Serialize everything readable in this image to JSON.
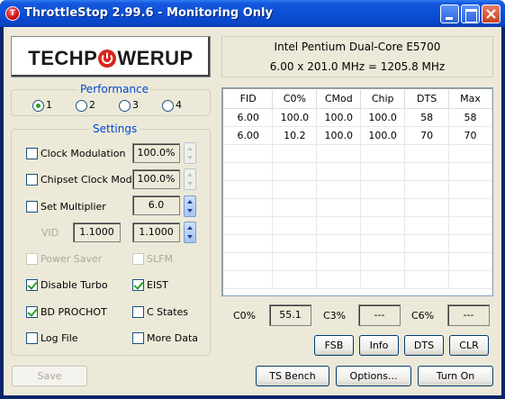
{
  "window": {
    "title": "ThrottleStop 2.99.6 - Monitoring Only",
    "app_icon_letter": "T"
  },
  "logo": {
    "text_left": "TECHP",
    "text_right": "WERUP",
    "brand_red": "#d7261e"
  },
  "performance": {
    "title": "Performance",
    "options": [
      "1",
      "2",
      "3",
      "4"
    ],
    "selected": "1"
  },
  "settings": {
    "title": "Settings",
    "clock_modulation": {
      "label": "Clock Modulation",
      "checked": false,
      "value": "100.0%"
    },
    "chipset_clock_mod": {
      "label": "Chipset Clock Mod",
      "checked": false,
      "value": "100.0%"
    },
    "set_multiplier": {
      "label": "Set Multiplier",
      "checked": false,
      "value": "6.0"
    },
    "vid": {
      "label": "VID",
      "value_left": "1.1000",
      "value_right": "1.1000"
    },
    "power_saver": {
      "label": "Power Saver",
      "checked": false
    },
    "slfm": {
      "label": "SLFM",
      "checked": false
    },
    "disable_turbo": {
      "label": "Disable Turbo",
      "checked": true
    },
    "eist": {
      "label": "EIST",
      "checked": true
    },
    "bd_prochot": {
      "label": "BD PROCHOT",
      "checked": true
    },
    "c_states": {
      "label": "C States",
      "checked": false
    },
    "log_file": {
      "label": "Log File",
      "checked": false
    },
    "more_data": {
      "label": "More Data",
      "checked": false
    }
  },
  "cpu": {
    "name": "Intel Pentium Dual-Core E5700",
    "freq": "6.00 x 201.0 MHz = 1205.8 MHz"
  },
  "table": {
    "headers": [
      "FID",
      "C0%",
      "CMod",
      "Chip",
      "DTS",
      "Max"
    ],
    "rows": [
      [
        "6.00",
        "100.0",
        "100.0",
        "100.0",
        "58",
        "58"
      ],
      [
        "6.00",
        "10.2",
        "100.0",
        "100.0",
        "70",
        "70"
      ]
    ]
  },
  "stats": {
    "c0_label": "C0%",
    "c0_value": "55.1",
    "c3_label": "C3%",
    "c3_value": "---",
    "c6_label": "C6%",
    "c6_value": "---"
  },
  "buttons": {
    "fsb": "FSB",
    "info": "Info",
    "dts": "DTS",
    "clr": "CLR",
    "save": "Save",
    "ts_bench": "TS Bench",
    "options": "Options...",
    "turn_on": "Turn On"
  }
}
